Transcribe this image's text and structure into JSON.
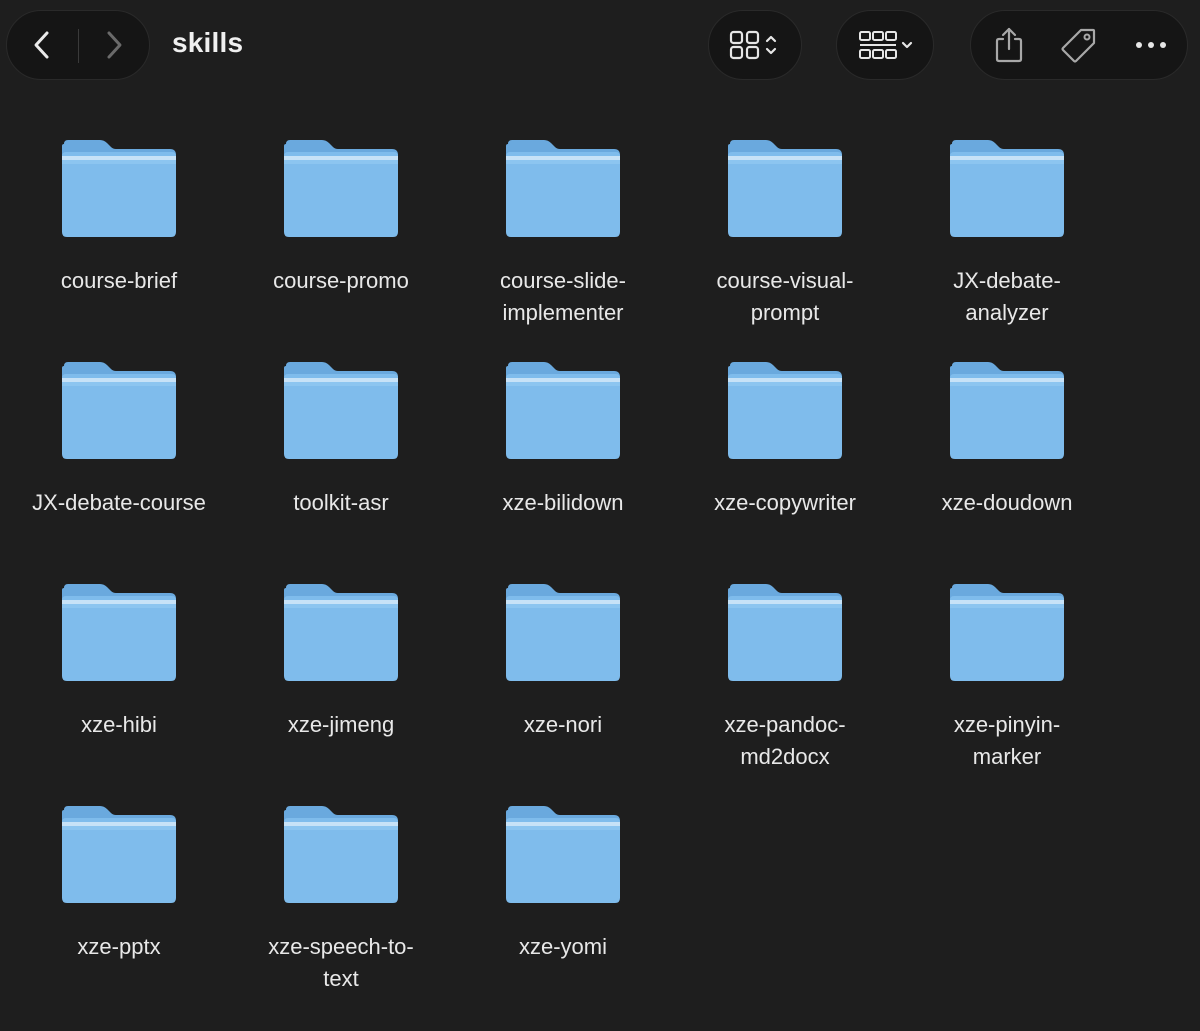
{
  "window": {
    "title": "skills"
  },
  "toolbar": {
    "back_icon": "chevron-left-icon",
    "forward_icon": "chevron-right-icon",
    "view_icon": "grid-view-icon",
    "group_icon": "group-by-icon",
    "share_icon": "share-icon",
    "tag_icon": "tag-icon",
    "more_icon": "ellipsis-icon"
  },
  "colors": {
    "background": "#1e1e1e",
    "folder_body": "#7fbcec",
    "folder_tab": "#6aa9de"
  },
  "folders": [
    {
      "name": "course-brief"
    },
    {
      "name": "course-promo"
    },
    {
      "name": "course-slide-\nimplementer"
    },
    {
      "name": "course-visual-\nprompt"
    },
    {
      "name": "JX-debate-\nanalyzer"
    },
    {
      "name": "JX-debate-course"
    },
    {
      "name": "toolkit-asr"
    },
    {
      "name": "xze-bilidown"
    },
    {
      "name": "xze-copywriter"
    },
    {
      "name": "xze-doudown"
    },
    {
      "name": "xze-hibi"
    },
    {
      "name": "xze-jimeng"
    },
    {
      "name": "xze-nori"
    },
    {
      "name": "xze-pandoc-\nmd2docx"
    },
    {
      "name": "xze-pinyin-\nmarker"
    },
    {
      "name": "xze-pptx"
    },
    {
      "name": "xze-speech-to-\ntext"
    },
    {
      "name": "xze-yomi"
    }
  ]
}
